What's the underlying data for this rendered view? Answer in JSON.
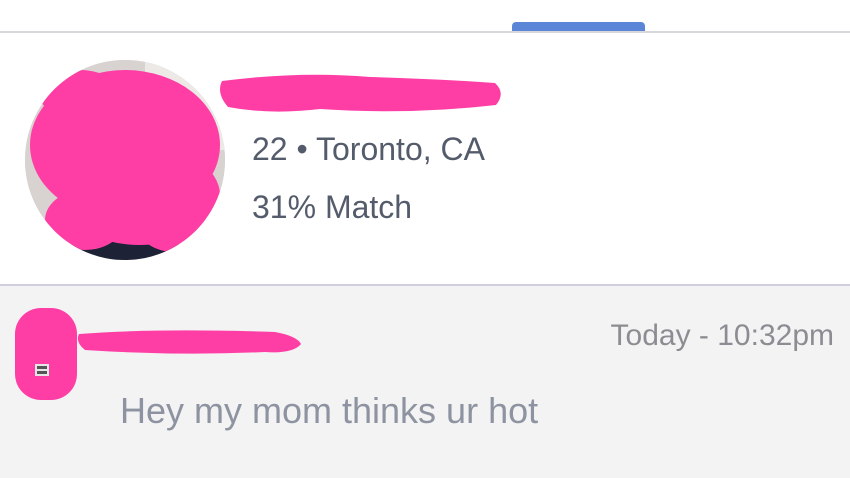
{
  "colors": {
    "accent": "#5b86d8",
    "redaction": "#ff3ea5",
    "meta_text": "#545c6c",
    "message_text": "#8d93a0",
    "timestamp_text": "#8c8c92",
    "message_bg": "#f3f3f4"
  },
  "profile": {
    "name": "",
    "meta": "22 • Toronto, CA",
    "match": "31% Match"
  },
  "message": {
    "sender": "",
    "timestamp": "Today - 10:32pm",
    "text": "Hey my mom thinks ur hot"
  }
}
